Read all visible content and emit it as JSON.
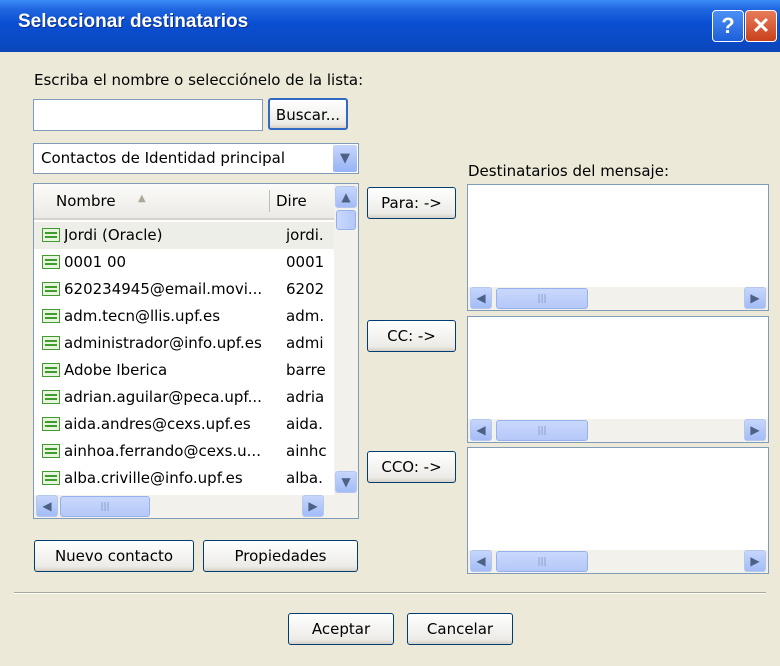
{
  "window": {
    "title": "Seleccionar destinatarios",
    "help_label": "?",
    "close_label": "✕"
  },
  "search": {
    "prompt": "Escriba el nombre o selecciónelo de la lista:",
    "value": "",
    "button_label": "Buscar..."
  },
  "addressbook": {
    "selected": "Contactos de Identidad principal"
  },
  "contacts": {
    "columns": {
      "name": "Nombre",
      "address": "Dire"
    },
    "rows": [
      {
        "name": "Jordi (Oracle)",
        "address": "jordi."
      },
      {
        "name": "0001 00",
        "address": "0001"
      },
      {
        "name": "620234945@email.movi...",
        "address": "6202"
      },
      {
        "name": "adm.tecn@llis.upf.es",
        "address": "adm."
      },
      {
        "name": "administrador@info.upf.es",
        "address": "admi"
      },
      {
        "name": "Adobe Iberica",
        "address": "barre"
      },
      {
        "name": "adrian.aguilar@peca.upf...",
        "address": "adria"
      },
      {
        "name": "aida.andres@cexs.upf.es",
        "address": "aida."
      },
      {
        "name": "ainhoa.ferrando@cexs.u...",
        "address": "ainhc"
      },
      {
        "name": "alba.criville@info.upf.es",
        "address": "alba."
      }
    ]
  },
  "recipients": {
    "heading": "Destinatarios del mensaje:",
    "to_label": "Para: ->",
    "cc_label": "CC: ->",
    "bcc_label": "CCO: ->"
  },
  "actions": {
    "new_contact": "Nuevo contacto",
    "properties": "Propiedades",
    "accept": "Aceptar",
    "cancel": "Cancelar"
  },
  "icons": {
    "help": "help-icon",
    "close": "close-icon",
    "dropdown": "chevron-down-icon",
    "contact": "contact-card-icon",
    "sort": "sort-ascending-icon"
  },
  "colors": {
    "titlebar": "#0a4fd1",
    "dialog_background": "#ece9d8",
    "button_border": "#003c74",
    "close_button": "#c8411b",
    "contact_icon": "#3f9d2e"
  }
}
